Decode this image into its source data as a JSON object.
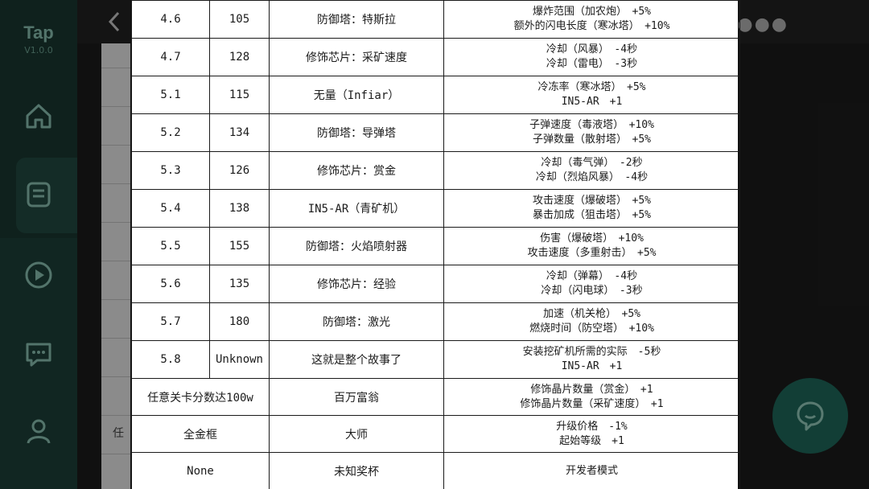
{
  "app": {
    "name": "Tap",
    "version": "V1.0.0"
  },
  "background": {
    "list_fragment": "任"
  },
  "icons": {
    "home": "home-icon",
    "list": "list-icon",
    "play": "play-icon",
    "message": "message-icon",
    "user": "user-icon",
    "back": "back-arrow-icon",
    "more": "more-dots-icon",
    "fab": "chat-bubble-icon"
  },
  "table": {
    "rows": [
      {
        "version": "4.6",
        "number": "105",
        "name": "防御塔：特斯拉",
        "effects": [
          "爆炸范围（加农炮）　+5%",
          "额外的闪电长度（寒冰塔）　+10%"
        ]
      },
      {
        "version": "4.7",
        "number": "128",
        "name": "修饰芯片：采矿速度",
        "effects": [
          "冷却（风暴）　-4秒",
          "冷却（雷电）　-3秒"
        ]
      },
      {
        "version": "5.1",
        "number": "115",
        "name": "无量（Infiar）",
        "effects": [
          "冷冻率（寒冰塔）　+5%",
          "IN5-AR　+1"
        ]
      },
      {
        "version": "5.2",
        "number": "134",
        "name": "防御塔：导弹塔",
        "effects": [
          "子弹速度（毒液塔）　+10%",
          "子弹数量（散射塔）　+5%"
        ]
      },
      {
        "version": "5.3",
        "number": "126",
        "name": "修饰芯片：赏金",
        "effects": [
          "冷却（毒气弹）　-2秒",
          "冷却（烈焰风暴）　-4秒"
        ]
      },
      {
        "version": "5.4",
        "number": "138",
        "name": "IN5-AR（青矿机）",
        "effects": [
          "攻击速度（爆破塔）　+5%",
          "暴击加成（狙击塔）　+5%"
        ]
      },
      {
        "version": "5.5",
        "number": "155",
        "name": "防御塔：火焰喷射器",
        "effects": [
          "伤害（爆破塔）　+10%",
          "攻击速度（多重射击）　+5%"
        ]
      },
      {
        "version": "5.6",
        "number": "135",
        "name": "修饰芯片：经验",
        "effects": [
          "冷却（弹幕）　-4秒",
          "冷却（闪电球）　-3秒"
        ]
      },
      {
        "version": "5.7",
        "number": "180",
        "name": "防御塔：激光",
        "effects": [
          "加速（机关枪）　+5%",
          "燃烧时间（防空塔）　+10%"
        ]
      },
      {
        "version": "5.8",
        "number": "Unknown",
        "name": "这就是整个故事了",
        "effects": [
          "安装挖矿机所需的实际　-5秒",
          "IN5-AR　+1"
        ]
      }
    ],
    "extra_rows": [
      {
        "condition": "任意关卡分数达100w",
        "name": "百万富翁",
        "effects": [
          "修饰晶片数量（赏金）　+1",
          "修饰晶片数量（采矿速度）　+1"
        ]
      },
      {
        "condition": "全金框",
        "name": "大师",
        "effects": [
          "升级价格　-1%",
          "起始等级　+1"
        ]
      },
      {
        "condition": "None",
        "name": "未知奖杯",
        "effects": [
          "开发者模式"
        ]
      }
    ]
  }
}
